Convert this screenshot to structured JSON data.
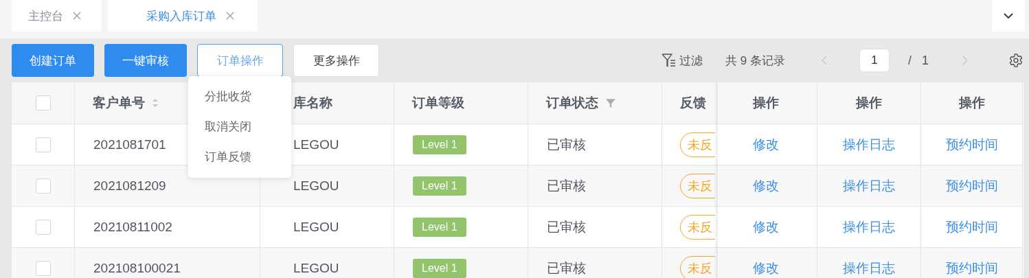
{
  "tabs": [
    {
      "label": "主控台",
      "selected": false
    },
    {
      "label": "采购入库订单",
      "selected": true
    }
  ],
  "toolbar": {
    "buttons": [
      {
        "label": "创建订单",
        "kind": "primary"
      },
      {
        "label": "一键审核",
        "kind": "primary"
      },
      {
        "label": "订单操作",
        "kind": "active"
      },
      {
        "label": "更多操作",
        "kind": "default"
      }
    ],
    "filter_label": "过滤",
    "record_count": "共 9 条记录",
    "page_input": "1",
    "page_separator": "/",
    "page_total": "1"
  },
  "dropdown": {
    "items": [
      "分批收货",
      "取消关闭",
      "订单反馈"
    ]
  },
  "table": {
    "select_all_checked": false,
    "columns": [
      {
        "label": "客户单号",
        "kind": "sortable"
      },
      {
        "label": "库名称",
        "kind": "plain"
      },
      {
        "label": "订单等级",
        "kind": "plain"
      },
      {
        "label": "订单状态",
        "kind": "filterable"
      },
      {
        "label": "反馈",
        "kind": "plain"
      },
      {
        "label": "操作",
        "kind": "plain"
      },
      {
        "label": "操作",
        "kind": "plain"
      },
      {
        "label": "操作",
        "kind": "plain"
      }
    ],
    "rows": [
      {
        "checked": false,
        "order_no": "2021081701",
        "warehouse": "LEGOU",
        "level": "Level 1",
        "status": "已审核",
        "feedback": "未反",
        "actions": [
          "修改",
          "操作日志",
          "预约时间"
        ]
      },
      {
        "checked": false,
        "order_no": "2021081209",
        "warehouse": "LEGOU",
        "level": "Level 1",
        "status": "已审核",
        "feedback": "未反",
        "actions": [
          "修改",
          "操作日志",
          "预约时间"
        ]
      },
      {
        "checked": false,
        "order_no": "20210811002",
        "warehouse": "LEGOU",
        "level": "Level 1",
        "status": "已审核",
        "feedback": "未反",
        "actions": [
          "修改",
          "操作日志",
          "预约时间"
        ]
      },
      {
        "checked": false,
        "order_no": "202108100021",
        "warehouse": "LEGOU",
        "level": "Level 1",
        "status": "已审核",
        "feedback": "未反",
        "actions": [
          "修改",
          "操作日志",
          "预约时间"
        ]
      }
    ]
  }
}
